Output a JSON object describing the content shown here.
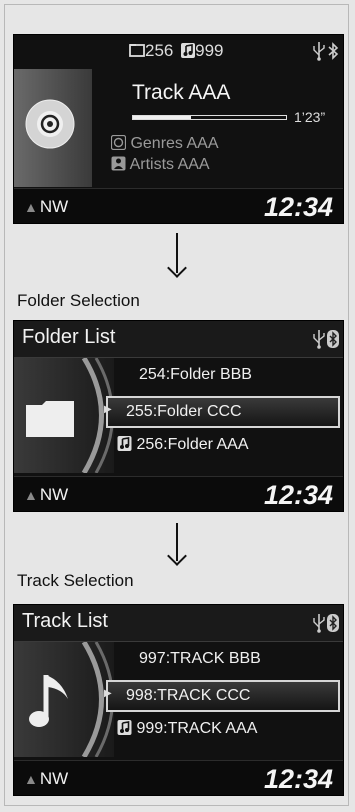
{
  "screen1": {
    "folder_count": "256",
    "song_count": "999",
    "track_title": "Track AAA",
    "elapsed": "1’23”",
    "progress": 0.38,
    "genre": "Genres AAA",
    "artist": "Artists AAA",
    "heading": "NW",
    "clock": "12:34"
  },
  "caption1": "Folder Selection",
  "screen2": {
    "title": "Folder List",
    "items": [
      "254:Folder BBB",
      "255:Folder CCC",
      "256:Folder AAA"
    ],
    "heading": "NW",
    "clock": "12:34"
  },
  "caption2": "Track Selection",
  "screen3": {
    "title": "Track List",
    "items": [
      "997:TRACK BBB",
      "998:TRACK CCC",
      "999:TRACK AAA"
    ],
    "heading": "NW",
    "clock": "12:34"
  },
  "icons": {
    "folder": "folder-icon",
    "song": "music-note-icon",
    "usb": "usb-icon",
    "bluetooth": "bluetooth-icon",
    "disc": "disc-icon",
    "genre": "genre-icon",
    "artist": "artist-icon"
  },
  "colors": {
    "screen_bg": "#111111",
    "text": "#f2f2f2",
    "dim": "#9a9a9a"
  }
}
